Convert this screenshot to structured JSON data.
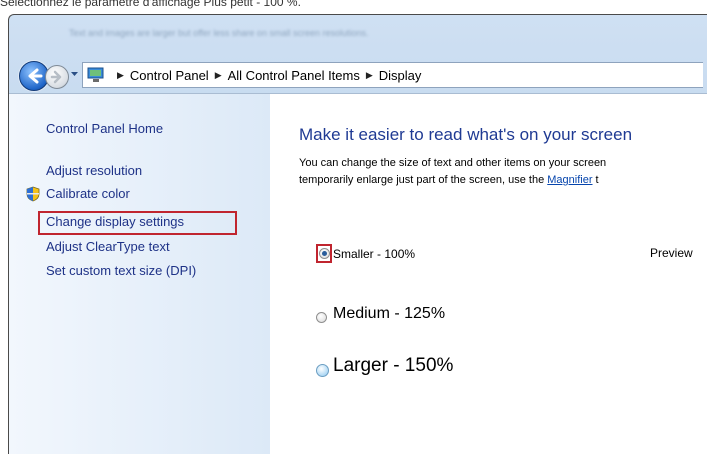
{
  "caption": "Sélectionnez le paramètre d'affichage Plus petit - 100 %.",
  "titlebar_blurred": "Text and images are larger but offer less share on small screen resolutions.",
  "address_bar": {
    "crumbs": [
      "Control Panel",
      "All Control Panel Items",
      "Display"
    ]
  },
  "left_pane": {
    "home": "Control Panel Home",
    "links": [
      "Adjust resolution",
      "Calibrate color",
      "Change display settings",
      "Adjust ClearType text",
      "Set custom text size (DPI)"
    ]
  },
  "main": {
    "title": "Make it easier to read what's on your screen",
    "desc_line1": "You can change the size of text and other items on your screen",
    "desc_line2_pre": "temporarily enlarge just part of the screen, use the ",
    "desc_link": "Magnifier",
    "desc_line2_post": " t",
    "options": [
      {
        "label": "Smaller - 100%",
        "selected": true
      },
      {
        "label": "Medium - 125%",
        "selected": false
      },
      {
        "label": "Larger - 150%",
        "selected": false
      }
    ],
    "preview_label": "Preview"
  },
  "colors": {
    "highlight": "#c0252f",
    "link": "#1e3287",
    "title": "#1f3a93"
  }
}
